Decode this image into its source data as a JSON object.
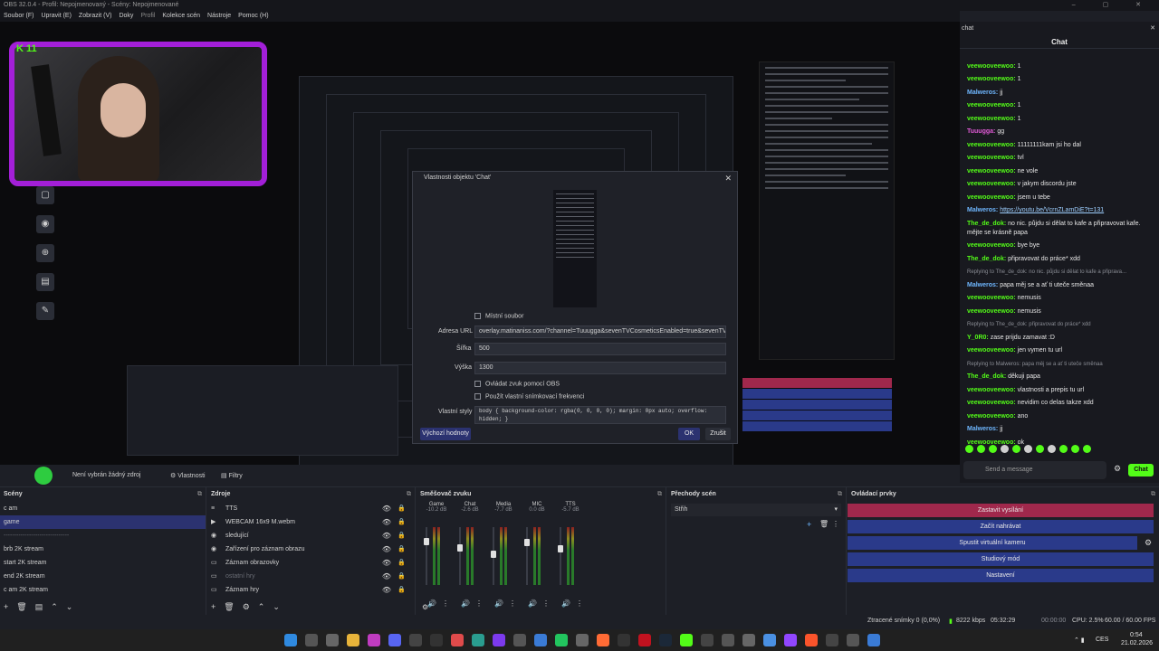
{
  "window": {
    "title": "OBS 32.0.4 - Profil: Nepojmenovaný - Scény: Nepojmenované"
  },
  "menu": [
    "Soubor (F)",
    "Upravit (E)",
    "Zobrazit (V)",
    "Doky",
    "Profil",
    "Kolekce scén",
    "Nástroje",
    "Pomoc (H)"
  ],
  "overlay": {
    "kick_count": "11"
  },
  "dialog": {
    "title": "Vlastnosti objektu 'Chat'",
    "local_file_label": "Místní soubor",
    "url_label": "Adresa URL",
    "url_value": "overlay.matinaniss.com/?channel=Tuuugga&sevenTVCosmeticsEnabled=true&sevenTVEm",
    "width_label": "Šířka",
    "width_value": "500",
    "height_label": "Výška",
    "height_value": "1300",
    "control_audio_label": "Ovládat zvuk pomocí OBS",
    "custom_fps_label": "Použít vlastní snímkovací frekvenci",
    "css_label": "Vlastní styly",
    "css_value": "body { background-color: rgba(0, 0, 0, 0); margin: 0px auto; overflow: hidden; }",
    "defaults_button": "Výchozí hodnoty",
    "ok_button": "OK",
    "cancel_button": "Zrušit"
  },
  "chat": {
    "dock_title": "chat",
    "title": "Chat",
    "messages": [
      {
        "user": "veewooveewoo:",
        "text": "1",
        "color": "u-green"
      },
      {
        "user": "veewooveewoo:",
        "text": "1",
        "color": "u-green"
      },
      {
        "user": "Malweros:",
        "text": "jj",
        "color": "u-blue"
      },
      {
        "user": "veewooveewoo:",
        "text": "1",
        "color": "u-green"
      },
      {
        "user": "veewooveewoo:",
        "text": "1",
        "color": "u-green"
      },
      {
        "user": "Tuuugga:",
        "text": "gg",
        "color": "u-pink"
      },
      {
        "user": "veewooveewoo:",
        "text": "11111111kam jsi ho dal",
        "color": "u-green"
      },
      {
        "user": "veewooveewoo:",
        "text": "tvl",
        "color": "u-green"
      },
      {
        "user": "veewooveewoo:",
        "text": "ne vole",
        "color": "u-green"
      },
      {
        "user": "veewooveewoo:",
        "text": "v jakym discordu jste",
        "color": "u-green"
      },
      {
        "user": "veewooveewoo:",
        "text": "jsem u tebe",
        "color": "u-green"
      },
      {
        "user": "Malweros:",
        "text": "https://youtu.be/VcrnZLamDiE?t=131",
        "color": "u-blue",
        "link": true
      },
      {
        "user": "The_de_dok:",
        "text": "no nic. půjdu si dělat to kafe a připravovat kafe. mějte se krásně papa",
        "color": "u-green"
      },
      {
        "user": "veewooveewoo:",
        "text": "bye bye",
        "color": "u-green"
      },
      {
        "user": "The_de_dok:",
        "text": "připravovat do práce* xdd",
        "color": "u-green"
      },
      {
        "reply": "Replying to The_de_dok: no nic. půjdu si dělat to kafe a připrava..."
      },
      {
        "user": "Malweros:",
        "text": "papa měj se a ať ti uteče směnaa",
        "color": "u-blue"
      },
      {
        "user": "veewooveewoo:",
        "text": "nemusis",
        "color": "u-green"
      },
      {
        "user": "veewooveewoo:",
        "text": "nemusis",
        "color": "u-green"
      },
      {
        "reply": "Replying to The_de_dok: připravovat do práce* xdd"
      },
      {
        "user": "Y_0R0:",
        "text": "zase prijdu zamavat :D",
        "color": "u-green"
      },
      {
        "user": "veewooveewoo:",
        "text": "jen vymen tu url",
        "color": "u-green"
      },
      {
        "reply": "Replying to Malweros: papa měj se a ať ti uteče směnaa"
      },
      {
        "user": "The_de_dok:",
        "text": "děkuji papa",
        "color": "u-green"
      },
      {
        "user": "veewooveewoo:",
        "text": "vlastnosti a prepis tu url",
        "color": "u-green"
      },
      {
        "user": "veewooveewoo:",
        "text": "nevidim co delas takze xdd",
        "color": "u-green"
      },
      {
        "user": "veewooveewoo:",
        "text": "ano",
        "color": "u-green"
      },
      {
        "user": "Malweros:",
        "text": "jj",
        "color": "u-blue"
      },
      {
        "user": "veewooveewoo:",
        "text": "ok",
        "color": "u-green"
      }
    ],
    "input_placeholder": "Send a message",
    "send_button": "Chat"
  },
  "source_toolbar": {
    "no_source": "Není vybrán žádný zdroj",
    "properties": "Vlastnosti",
    "filters": "Filtry"
  },
  "scenes": {
    "title": "Scény",
    "items": [
      "c am",
      "game",
      "-------------------------------",
      "brb 2K stream",
      "start 2K stream",
      "end 2K stream",
      "c am 2K stream"
    ],
    "selected_index": 1
  },
  "sources": {
    "title": "Zdroje",
    "items": [
      {
        "label": "TTS",
        "icon": "≡",
        "dim": false
      },
      {
        "label": "WEBCAM 16x9 M.webm",
        "icon": "▶",
        "dim": false
      },
      {
        "label": "sledující",
        "icon": "◉",
        "dim": false
      },
      {
        "label": "Zařízení pro záznam obrazu",
        "icon": "◉",
        "dim": false
      },
      {
        "label": "Záznam obrazovky",
        "icon": "▭",
        "dim": false
      },
      {
        "label": "ostatní hry",
        "icon": "▭",
        "dim": true
      },
      {
        "label": "Záznam hry",
        "icon": "▭",
        "dim": false
      }
    ]
  },
  "mixer": {
    "title": "Směšovač zvuku",
    "channels": [
      {
        "name": "Game",
        "db": "-10.2 dB"
      },
      {
        "name": "Chat",
        "db": "-2.6 dB"
      },
      {
        "name": "Media",
        "db": "-7.7 dB"
      },
      {
        "name": "MIC",
        "db": "0.0 dB"
      },
      {
        "name": "TTS",
        "db": "-5.7 dB"
      }
    ]
  },
  "transitions": {
    "title": "Přechody scén",
    "selected": "Střih"
  },
  "controls": {
    "title": "Ovládací prvky",
    "stop_stream": "Zastavit vysílání",
    "start_recording": "Začít nahrávat",
    "virtual_camera": "Spustit virtuální kameru",
    "studio_mode": "Studiový mód",
    "settings": "Nastavení"
  },
  "status": {
    "dropped_frames": "Ztracené snímky 0 (0,0%)",
    "bitrate": "8222 kbps",
    "stream_time": "05:32:29",
    "record_time": "00:00:00",
    "cpu": "CPU: 2.5%",
    "fps": "60.00 / 60.00 FPS"
  },
  "taskbar": {
    "language": "CES",
    "time": "0:54",
    "date": "21.02.2026"
  },
  "colors": {
    "kick_green": "#53fc18",
    "webcam_border": "#a31fd8",
    "stop_stream": "#a0284c",
    "control_blue": "#2a3a8a"
  }
}
